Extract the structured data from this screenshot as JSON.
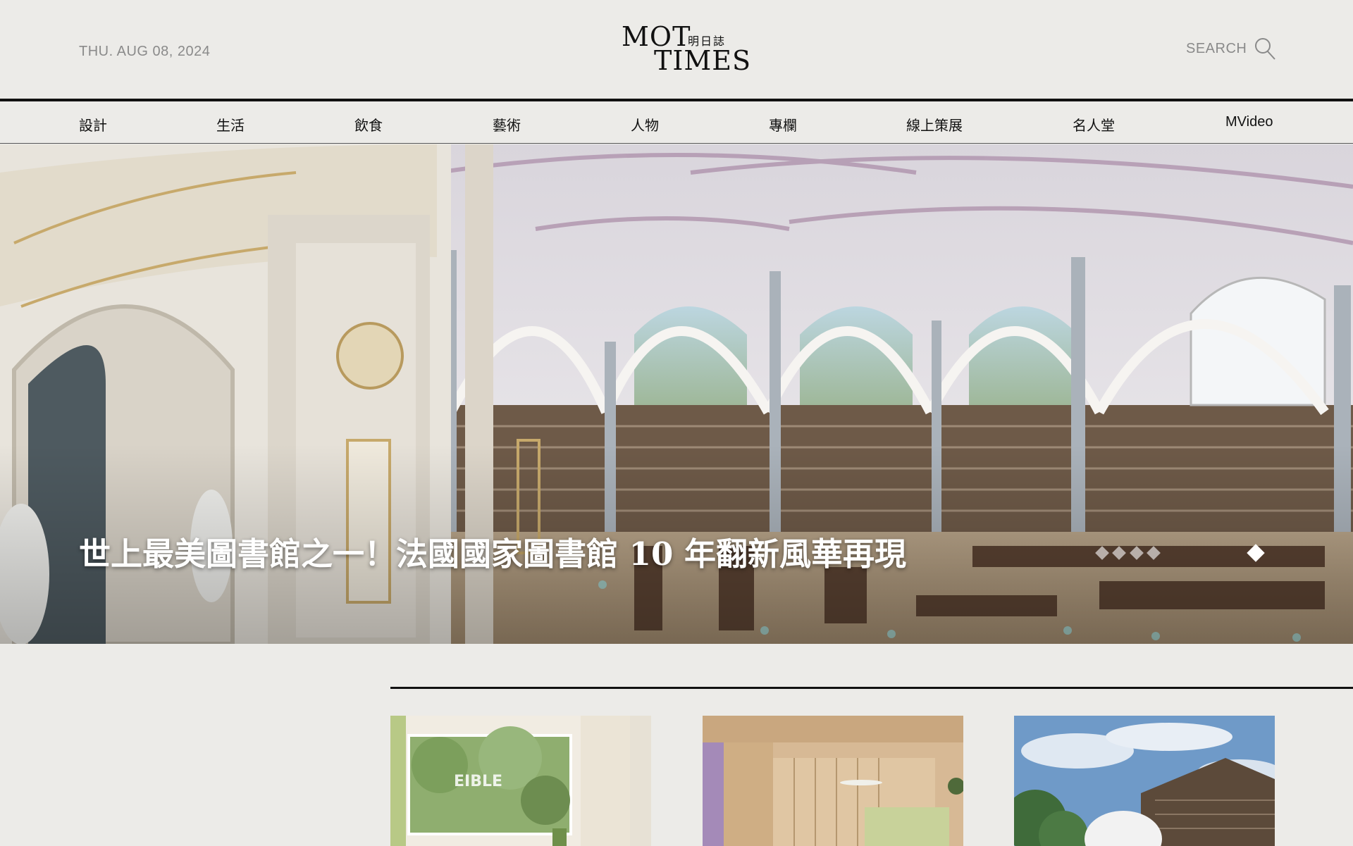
{
  "header": {
    "date": "THU. AUG 08, 2024",
    "logo": {
      "line1": "MOT",
      "line2": "TIMES",
      "cn": "明日誌"
    },
    "search_label": "SEARCH"
  },
  "nav": {
    "items": [
      {
        "label": "設計"
      },
      {
        "label": "生活"
      },
      {
        "label": "飲食"
      },
      {
        "label": "藝術"
      },
      {
        "label": "人物"
      },
      {
        "label": "專欄"
      },
      {
        "label": "線上策展"
      },
      {
        "label": "名人堂"
      },
      {
        "label": "MVideo"
      }
    ]
  },
  "hero": {
    "title": "世上最美圖書館之一！法國國家圖書館 10 年翻新風華再現",
    "slides": 5,
    "active_slide": 5
  },
  "cards": [
    {
      "icon": "cafe-interior-image"
    },
    {
      "icon": "wood-office-image"
    },
    {
      "icon": "building-exterior-image"
    }
  ],
  "colors": {
    "background": "#ecebe8",
    "text": "#111111",
    "muted": "#8a8a8a"
  }
}
